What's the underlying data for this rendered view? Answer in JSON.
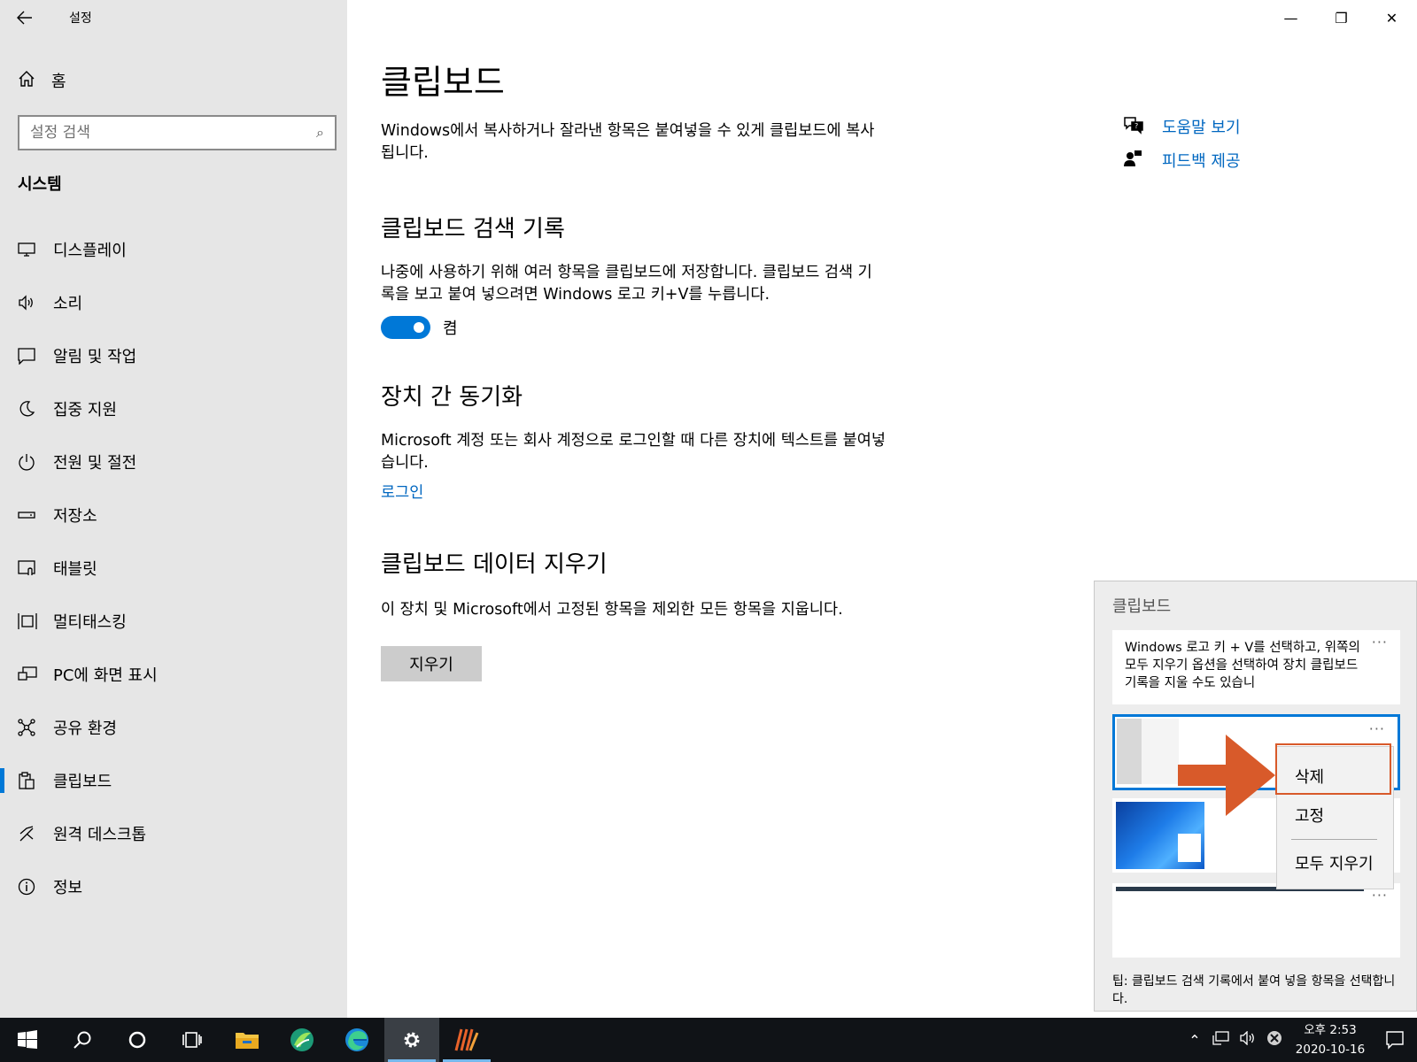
{
  "window": {
    "title": "설정",
    "back_icon": "arrow-left-icon",
    "minimize_glyph": "—",
    "maximize_glyph": "❐",
    "close_glyph": "✕"
  },
  "sidebar": {
    "home_label": "홈",
    "search_placeholder": "설정 검색",
    "section_title": "시스템",
    "items": [
      {
        "label": "디스플레이",
        "icon": "display-icon"
      },
      {
        "label": "소리",
        "icon": "speaker-icon"
      },
      {
        "label": "알림 및 작업",
        "icon": "message-icon"
      },
      {
        "label": "집중 지원",
        "icon": "moon-icon"
      },
      {
        "label": "전원 및 절전",
        "icon": "power-icon"
      },
      {
        "label": "저장소",
        "icon": "storage-icon"
      },
      {
        "label": "태블릿",
        "icon": "tablet-icon"
      },
      {
        "label": "멀티태스킹",
        "icon": "multitasking-icon"
      },
      {
        "label": "PC에 화면 표시",
        "icon": "project-icon"
      },
      {
        "label": "공유 환경",
        "icon": "share-icon"
      },
      {
        "label": "클립보드",
        "icon": "clipboard-icon",
        "active": true
      },
      {
        "label": "원격 데스크톱",
        "icon": "remote-desktop-icon"
      },
      {
        "label": "정보",
        "icon": "info-icon"
      }
    ]
  },
  "main": {
    "title": "클립보드",
    "intro": "Windows에서 복사하거나 잘라낸 항목은 붙여넣을 수 있게 클립보드에 복사됩니다.",
    "history": {
      "heading": "클립보드 검색 기록",
      "desc": "나중에 사용하기 위해 여러 항목을 클립보드에 저장합니다. 클립보드 검색 기록을 보고 붙여 넣으려면 Windows 로고 키+V를 누릅니다.",
      "toggle_state": "켬",
      "toggle_on": true
    },
    "sync": {
      "heading": "장치 간 동기화",
      "desc": "Microsoft 계정 또는 회사 계정으로 로그인할 때 다른 장치에 텍스트를 붙여넣습니다.",
      "link": "로그인"
    },
    "clear": {
      "heading": "클립보드 데이터 지우기",
      "desc": "이 장치 및 Microsoft에서 고정된 항목을 제외한 모든 항목을 지웁니다.",
      "button": "지우기"
    }
  },
  "help": {
    "help_link": "도움말 보기",
    "feedback_link": "피드백 제공"
  },
  "flyout": {
    "title": "클립보드",
    "item_text": "Windows 로고 키 + V를 선택하고, 위쪽의 모두 지우기 옵션을 선택하여 장치 클립보드 기록을 지울 수도 있습니",
    "dots": "···",
    "menu": {
      "delete": "삭제",
      "pin": "고정",
      "clear_all": "모두 지우기"
    },
    "tip": "팁: 클립보드 검색 기록에서 붙여 넣을 항목을 선택합니다."
  },
  "taskbar": {
    "time": "오후 2:53",
    "date": "2020-10-16",
    "apps": [
      "start-icon",
      "search-icon",
      "cortana-icon",
      "task-view-icon",
      "file-explorer-icon",
      "app-icon",
      "edge-icon",
      "settings-icon",
      "media-app-icon"
    ]
  },
  "colors": {
    "accent": "#0078d7",
    "link": "#0067c0",
    "highlight": "#d85a2a"
  }
}
